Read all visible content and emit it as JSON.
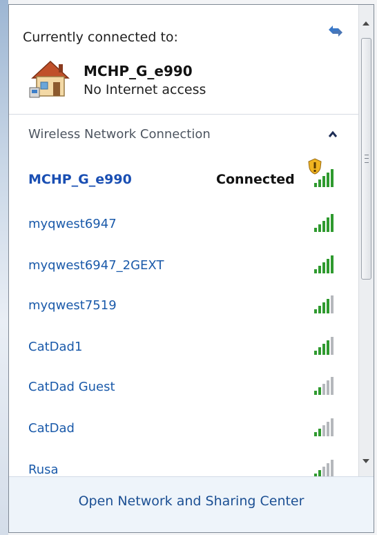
{
  "connected": {
    "header": "Currently connected to:",
    "network_name": "MCHP_G_e990",
    "status": "No Internet access"
  },
  "section": {
    "title": "Wireless Network Connection"
  },
  "networks": [
    {
      "name": "MCHP_G_e990",
      "status": "Connected",
      "signal_bars": 5,
      "secured_warning": true
    },
    {
      "name": "myqwest6947",
      "signal_bars": 5
    },
    {
      "name": "myqwest6947_2GEXT",
      "signal_bars": 5
    },
    {
      "name": "myqwest7519",
      "signal_bars": 4
    },
    {
      "name": "CatDad1",
      "signal_bars": 4
    },
    {
      "name": "CatDad Guest",
      "signal_bars": 2
    },
    {
      "name": "CatDad",
      "signal_bars": 2
    },
    {
      "name": "Rusa",
      "signal_bars": 2
    }
  ],
  "footer": {
    "link": "Open Network and Sharing Center"
  },
  "colors": {
    "link": "#1a5aaa",
    "signal_on": "#2f9a2f",
    "signal_off": "#b5b8bc"
  }
}
